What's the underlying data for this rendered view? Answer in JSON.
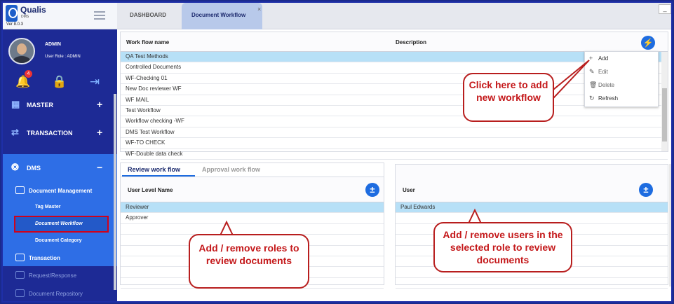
{
  "app": {
    "logo_name": "Qualis",
    "logo_sub": "DMS",
    "version": "Ver 8.0.3"
  },
  "user": {
    "name": "ADMIN",
    "role": "User Role : ADMIN",
    "notification_count": "4"
  },
  "sidebar": {
    "master": "MASTER",
    "transaction": "TRANSACTION",
    "dms": "DMS",
    "document_management": "Document Management",
    "tag_master": "Tag Master",
    "document_workflow": "Document Workflow",
    "document_category": "Document Category",
    "dms_transaction": "Transaction",
    "request_response": "Request/Response",
    "document_repository": "Document Repository"
  },
  "tabs": {
    "dashboard": "DASHBOARD",
    "document_workflow": "Document Workflow",
    "close": "×"
  },
  "workflow_table": {
    "col_name": "Work flow name",
    "col_description": "Description",
    "rows": [
      "QA Test Methods",
      "Controlled Documents",
      "WF-Checking 01",
      "New Doc reviewer WF",
      "WF MAIL",
      "Test Workflow",
      "Workflow checking -WF",
      "DMS Test Workflow",
      "WF-TO CHECK",
      "WF-Double data check"
    ]
  },
  "menu": {
    "add": "Add",
    "edit": "Edit",
    "delete": "Delete",
    "refresh": "Refresh"
  },
  "review_tabs": {
    "review": "Review work flow",
    "approval": "Approval work flow"
  },
  "levels": {
    "header": "User Level Name",
    "rows": [
      "Reviewer",
      "Approver"
    ]
  },
  "users": {
    "header": "User",
    "rows": [
      "Paul Edwards"
    ]
  },
  "callouts": {
    "add_workflow": "Click here to add new workflow",
    "roles": "Add / remove roles to review documents",
    "users": "Add / remove users in the selected role  to review documents"
  }
}
